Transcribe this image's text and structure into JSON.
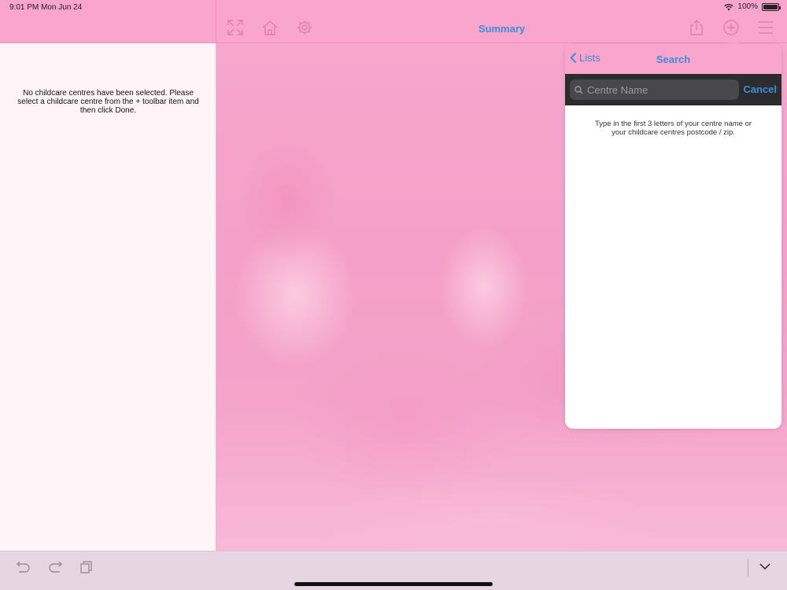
{
  "status": {
    "time": "9:01 PM   Mon Jun 24",
    "battery": "100%"
  },
  "nav": {
    "title": "Summary",
    "icons_left": [
      "expand-icon",
      "home-icon",
      "gear-icon"
    ],
    "icons_right": [
      "share-icon",
      "add-circle-icon",
      "menu-icon"
    ]
  },
  "left_pane": {
    "message": "No childcare centres have been selected. Please select a childcare centre from the + toolbar item and then click Done."
  },
  "popover": {
    "back_label": "Lists",
    "title": "Search",
    "search_placeholder": "Centre Name",
    "search_value": "",
    "cancel_label": "Cancel",
    "hint": "Type in the first 3 letters of your centre name or your childcare centres postcode / zip."
  },
  "toolbar": {
    "icons": [
      "undo-icon",
      "redo-icon",
      "copy-icon",
      "chevron-down-icon"
    ]
  },
  "colors": {
    "accent": "#3a8fd6",
    "nav_bg": "#f9a5cd",
    "toolbar_bg": "#e6d6e2"
  }
}
